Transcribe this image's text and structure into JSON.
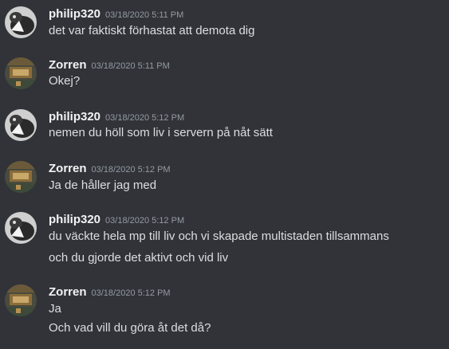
{
  "messages": [
    {
      "author": "philip320",
      "avatar_icon": "philip320-avatar-icon",
      "timestamp": "03/18/2020 5:11 PM",
      "lines": [
        "det var faktiskt förhastat att demota dig"
      ]
    },
    {
      "author": "Zorren",
      "avatar_icon": "zorren-avatar-icon",
      "timestamp": "03/18/2020 5:11 PM",
      "lines": [
        "Okej?"
      ]
    },
    {
      "author": "philip320",
      "avatar_icon": "philip320-avatar-icon",
      "timestamp": "03/18/2020 5:12 PM",
      "lines": [
        "nemen du höll som liv i servern på nåt sätt"
      ]
    },
    {
      "author": "Zorren",
      "avatar_icon": "zorren-avatar-icon",
      "timestamp": "03/18/2020 5:12 PM",
      "lines": [
        "Ja de håller jag med"
      ]
    },
    {
      "author": "philip320",
      "avatar_icon": "philip320-avatar-icon",
      "timestamp": "03/18/2020 5:12 PM",
      "lines": [
        "du väckte hela mp till liv och vi skapade multistaden tillsammans",
        "och du gjorde det aktivt och vid liv"
      ]
    },
    {
      "author": "Zorren",
      "avatar_icon": "zorren-avatar-icon",
      "timestamp": "03/18/2020 5:12 PM",
      "lines": [
        "Ja",
        "Och vad vill du göra åt det då?"
      ]
    }
  ],
  "colors": {
    "background": "#313338",
    "username": "#f2f3f5",
    "timestamp": "#949ba4",
    "message_text": "#dbdee1"
  }
}
